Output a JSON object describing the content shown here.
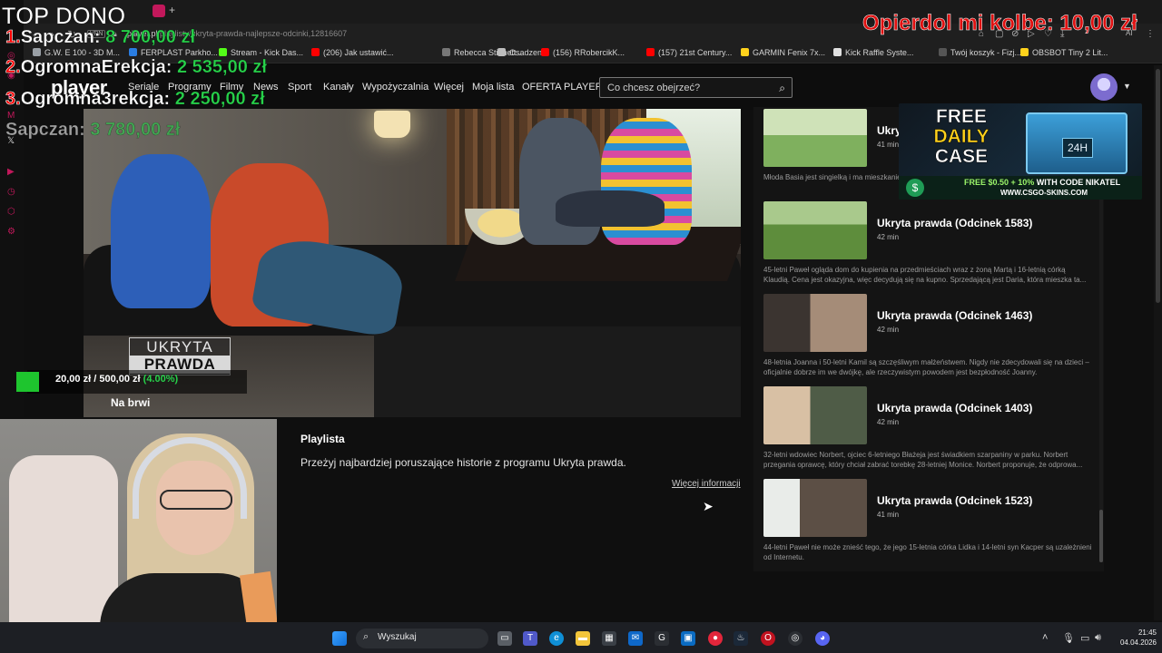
{
  "browser": {
    "vpn_label": "VPN",
    "url_host": "player.pl",
    "url_path": "/playlisty/ukryta-prawda-najlepsze-odcinki,12816607",
    "bookmarks": [
      {
        "label": "G.W. E 100 - 3D M...",
        "color": "#9aa0a6"
      },
      {
        "label": "FERPLAST Parkho...",
        "color": "#2a7de1"
      },
      {
        "label": "Stream - Kick Das...",
        "color": "#53fc18"
      },
      {
        "label": "(206) Jak ustawić...",
        "color": "#ff0000"
      },
      {
        "label": "Rebecca Stinnett...",
        "color": "#777777"
      },
      {
        "label": "Osadzeni",
        "color": "#bdbdbd"
      },
      {
        "label": "(156) RRobercikK...",
        "color": "#ff0000"
      },
      {
        "label": "(157) 21st Century...",
        "color": "#ff0000"
      },
      {
        "label": "GARMIN Fenix 7x...",
        "color": "#ffd21c"
      },
      {
        "label": "Kick Raffle Syste...",
        "color": "#e0e0e0"
      },
      {
        "label": "Twój koszyk - Fizj...",
        "color": "#555555"
      },
      {
        "label": "OBSBOT Tiny 2 Lit...",
        "color": "#ffd21c"
      }
    ]
  },
  "site": {
    "logo": "player",
    "nav": [
      "Seriale",
      "Programy",
      "Filmy",
      "News",
      "Sport",
      "Kanały",
      "Wypożyczalnia",
      "Więcej",
      "Moja lista",
      "OFERTA PLAYER"
    ],
    "search_placeholder": "Co chcesz obejrzeć?",
    "accent": "#ffffff"
  },
  "video": {
    "show_logo_line1": "UKRYTA",
    "show_logo_line2": "PRAWDA"
  },
  "playlist": {
    "heading": "Playlista",
    "description": "Przeżyj najbardziej poruszające historie z programu Ukryta prawda.",
    "more_link": "Więcej informacji"
  },
  "episodes": [
    {
      "title": "Ukryta prawda (Odcinek 1550)",
      "duration": "41 min",
      "desc": "Młoda Basia jest singielką i ma mieszkanie... mechanik samochodowy oraz właściciel warsztatu..."
    },
    {
      "title": "Ukryta prawda (Odcinek 1583)",
      "duration": "42 min",
      "desc": "45-letni Paweł ogląda dom do kupienia na przedmieściach wraz z żoną Martą i 16-letnią córką Klaudią. Cena jest okazyjna, więc decydują się na kupno. Sprzedającą jest Daria, która mieszka ta..."
    },
    {
      "title": "Ukryta prawda (Odcinek 1463)",
      "duration": "42 min",
      "desc": "48-letnia Joanna i 50-letni Kamil są szczęśliwym małżeństwem. Nigdy nie zdecydowali się na dzieci – oficjalnie dobrze im we dwójkę, ale rzeczywistym powodem jest bezpłodność Joanny."
    },
    {
      "title": "Ukryta prawda (Odcinek 1403)",
      "duration": "42 min",
      "desc": "32-letni wdowiec Norbert, ojciec 6-letniego Błażeja jest świadkiem szarpaniny w parku. Norbert przegania oprawcę, który chciał zabrać torebkę 28-letniej Monice. Norbert proponuje, że odprowa..."
    },
    {
      "title": "Ukryta prawda (Odcinek 1523)",
      "duration": "41 min",
      "desc": "44-letni Paweł nie może znieść tego, że jego 15-letnia córka Lidka i 14-letni syn Kacper są uzależnieni od Internetu."
    }
  ],
  "overlay": {
    "top_title": "TOP DONO",
    "ranking": [
      {
        "rank": "1.",
        "name": "Sapczan:",
        "amount": "8 700,00 zł"
      },
      {
        "rank": "2.",
        "name": "OgromnaErekcja:",
        "amount": "2 535,00 zł"
      },
      {
        "rank": "3.",
        "name": "Ogromna3rekcja:",
        "amount": "2 250,00 zł"
      },
      {
        "rank": "",
        "name": "Sapczan:",
        "amount": "3 780,00 zł"
      }
    ],
    "top_right_name": "Opierdol mi kolbe:",
    "top_right_amount": "10,00 zł",
    "goal_current": "20,00 zł",
    "goal_sep": "/",
    "goal_target": "500,00 zł",
    "goal_percent": "(4.00%)",
    "goal_fraction": 0.04,
    "goal_label": "Na brwi"
  },
  "ad": {
    "line1": "FREE",
    "line2": "DAILY",
    "line3": "CASE",
    "box_label": "24H",
    "promo_a": "FREE $0.50 + 10%",
    "promo_b": " WITH CODE NIKATEL",
    "site": "WWW.CSGO-SKINS.COM",
    "coin": "$"
  },
  "taskbar": {
    "search_placeholder": "Wyszukaj",
    "time": "21:45",
    "date": "04.04.2026"
  }
}
